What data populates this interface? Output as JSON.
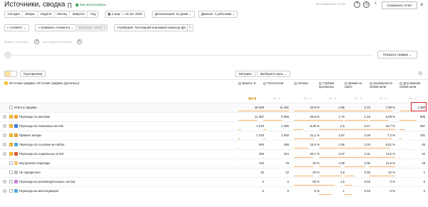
{
  "header": {
    "title": "Источники, сводка",
    "howto": "Как использовать",
    "counter": "100% визитов из 15 349",
    "save_label": "Сохранить отчет",
    "close": "×"
  },
  "toolbar": {
    "periods": [
      "Сегодня",
      "Вчера",
      "Неделя",
      "Месяц",
      "Квартал",
      "Год"
    ],
    "date_range": "1 мар — 10 окт 2023",
    "detail": "Детализация: по дням",
    "robots": "Данные: с роботами"
  },
  "segments": {
    "segment": "Сегмент",
    "compare": "Сравнить сегменты",
    "sample": "Выборка: 100%",
    "attribution": "Атрибуция: Последний значимый переход (ф)"
  },
  "filters": {
    "visits_hint": "Визиты, в которых",
    "users_hint": "для людей, у которых"
  },
  "graph": {
    "show_label": "Показать график"
  },
  "table_controls": {
    "grouping": "Группировки",
    "metrics": "Метрики",
    "goal": "Выберите цель"
  },
  "table": {
    "dimension_header": "Источник трафика, Источник трафика (детально)",
    "columns": [
      {
        "name": "Визиты",
        "sort": "▼"
      },
      {
        "name": "Посетители"
      },
      {
        "name": "Отказы"
      },
      {
        "name": "Глубина просмотра"
      },
      {
        "name": "Время на сайте"
      },
      {
        "name": "Конверсия по любой цели"
      },
      {
        "name": "Достижения любой цели"
      }
    ],
    "sub_icons": "% ↓ .ıl",
    "total": {
      "label": "Итого и средние",
      "values": [
        "15 349",
        "11 451",
        "23,9 %",
        "1,85",
        "1:23",
        "7,98 %",
        "1 380"
      ]
    },
    "rows": [
      {
        "label": "Переходы по рекламе",
        "checked": true,
        "expandable": true,
        "icon_color": "#f0a030",
        "values": [
          "11 387",
          "8 566",
          "26,8 %",
          "1,76",
          "1:16",
          "6,09 %",
          "905"
        ]
      },
      {
        "label": "Переходы из поисковых систем",
        "checked": true,
        "expandable": true,
        "icon_color": "#3a78d8",
        "values": [
          "1 676",
          "1 380",
          "9,35 %",
          "2,5",
          "2:17",
          "15,7 %",
          "287"
        ]
      },
      {
        "label": "Прямые заходы",
        "checked": true,
        "expandable": true,
        "icon_color": "#e0a12e",
        "values": [
          "1 223",
          "1 052",
          "21,1 %",
          "1,87",
          "1:29",
          "7,2 %",
          "101"
        ]
      },
      {
        "label": "Переходы по ссылкам на сайтах",
        "checked": true,
        "expandable": true,
        "icon_color": "#4aa8d8",
        "values": [
          "545",
          "466",
          "15,6 %",
          "1,96",
          "1:20",
          "6,61 %",
          "46"
        ]
      },
      {
        "label": "Переходы из социальных сетей",
        "checked": true,
        "expandable": true,
        "icon_color": "#e0542a",
        "values": [
          "294",
          "244",
          "20,1 %",
          "2,07",
          "1:31",
          "11,6 %",
          "34"
        ]
      },
      {
        "label": "Внутренние переходы",
        "checked": false,
        "expandable": false,
        "icon_color": "#f1c66a",
        "values": [
          "110",
          "76",
          "20 %",
          "1,56",
          "1:06",
          "11,8 %",
          "18"
        ]
      },
      {
        "label": "Не определено",
        "checked": false,
        "expandable": false,
        "icon_color": "#bbbbbb",
        "values": [
          "10",
          "10",
          "20 %",
          "1,8",
          "0:33",
          "10 %",
          "1"
        ]
      },
      {
        "label": "Переходы из рекомендательных систем",
        "checked": false,
        "expandable": true,
        "icon_color": "#c97be0",
        "values": [
          "2",
          "2",
          "50 %",
          "1,5",
          "0:15",
          "0 %",
          "0"
        ]
      },
      {
        "label": "Переходы из мессенджеров",
        "checked": false,
        "expandable": true,
        "icon_color": "#4aa8d8",
        "values": [
          "2",
          "2",
          "0 %",
          "1",
          "0:15",
          "0 %",
          "0"
        ]
      }
    ],
    "bar_fractions": [
      [
        1,
        1,
        1,
        1,
        1,
        0.9,
        0.66
      ],
      [
        0.74,
        0.75,
        1,
        0.95,
        0.92,
        0.76,
        0.66
      ],
      [
        0.11,
        0.12,
        0.35,
        1,
        1,
        1,
        0.21
      ],
      [
        0.08,
        0.09,
        0.79,
        1,
        1,
        0.9,
        0.07
      ],
      [
        0.04,
        0.04,
        0.58,
        1,
        1,
        0.8,
        0.03
      ],
      [
        0.02,
        0.02,
        0.75,
        1,
        1,
        1,
        0.02
      ],
      [
        0.01,
        0.01,
        0.75,
        0.85,
        0.8,
        1,
        0.01
      ],
      [
        0,
        0,
        0.75,
        0.9,
        0.4,
        1,
        0
      ],
      [
        0,
        0,
        1,
        0.6,
        0.3,
        0,
        0
      ],
      [
        0,
        0,
        0,
        0.5,
        0.3,
        0,
        0
      ]
    ]
  }
}
